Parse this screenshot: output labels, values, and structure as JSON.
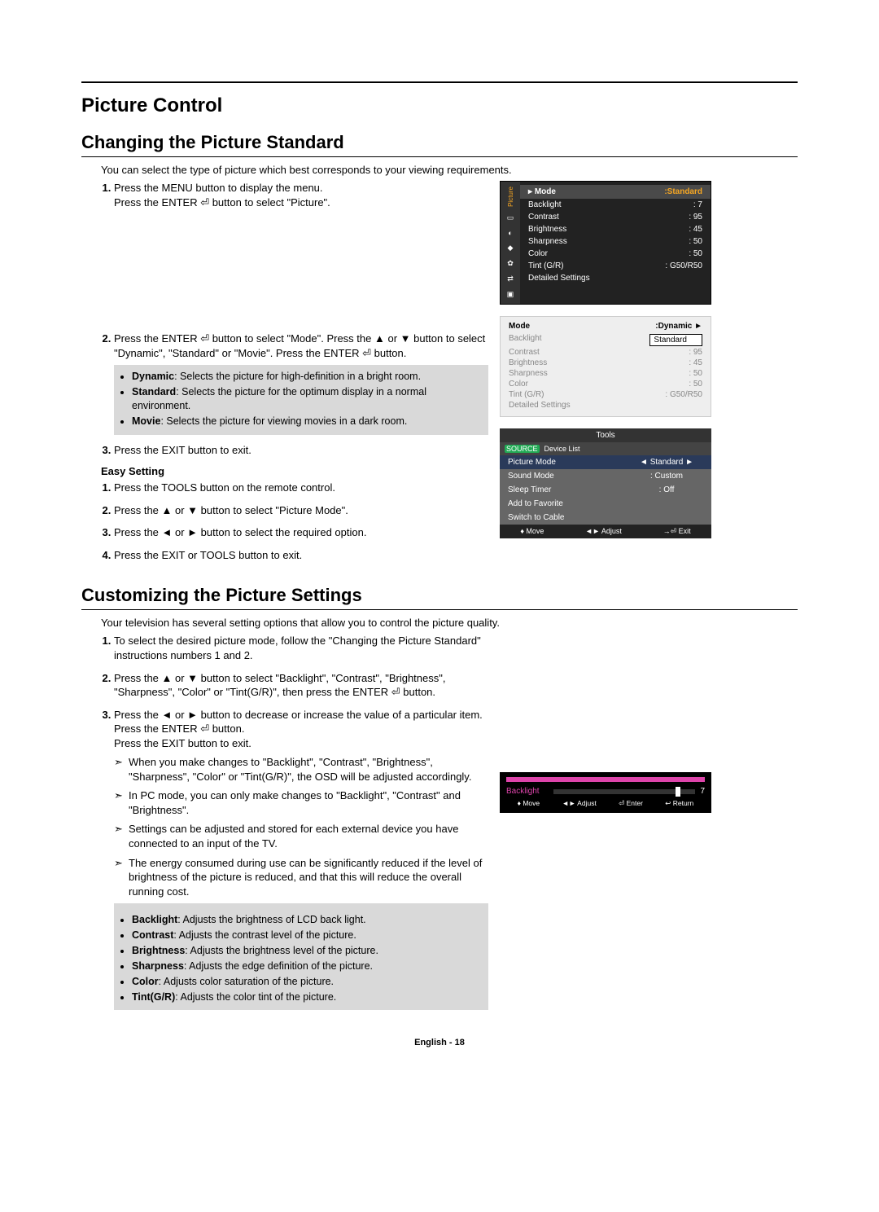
{
  "section1_title": "Picture Control",
  "section2_title": "Changing the Picture Standard",
  "intro1": "You can select the type of picture which best corresponds to your viewing requirements.",
  "step1a": "Press the MENU button to display the menu.",
  "step1b": "Press the ENTER ⏎ button to select \"Picture\".",
  "step2a": "Press the ENTER ⏎ button to select \"Mode\". Press the ▲ or ▼ button to select \"Dynamic\", \"Standard\" or \"Movie\". Press the ENTER ⏎ button.",
  "mode_dynamic_lbl": "Dynamic",
  "mode_dynamic_txt": ": Selects the picture for high-definition in a bright room.",
  "mode_standard_lbl": "Standard",
  "mode_standard_txt": ": Selects the picture for the optimum display in a normal environment.",
  "mode_movie_lbl": "Movie",
  "mode_movie_txt": ": Selects the picture for viewing movies in a dark room.",
  "step3": "Press the EXIT button to exit.",
  "easy_title": "Easy Setting",
  "easy1": "Press the TOOLS button on the remote control.",
  "easy2": "Press the ▲ or ▼ button to select \"Picture Mode\".",
  "easy3": "Press the ◄ or ► button to select the required option.",
  "easy4": "Press the EXIT or TOOLS button to exit.",
  "section3_title": "Customizing the Picture Settings",
  "intro2": "Your television has several setting options that allow you to control the picture quality.",
  "c_step1": "To select the desired picture mode, follow the \"Changing the Picture Standard\" instructions numbers 1 and 2.",
  "c_step2": "Press the ▲ or ▼ button to select \"Backlight\", \"Contrast\", \"Brightness\", \"Sharpness\", \"Color\" or \"Tint(G/R)\", then press the ENTER ⏎ button.",
  "c_step3a": "Press the ◄ or ► button to decrease or increase the value of a particular item. Press the ENTER ⏎ button.",
  "c_step3b": "Press the EXIT button to exit.",
  "note1": "When you make changes to \"Backlight\", \"Contrast\", \"Brightness\", \"Sharpness\", \"Color\" or \"Tint(G/R)\", the OSD will be adjusted accordingly.",
  "note2": "In PC mode, you can only make changes to \"Backlight\", \"Contrast\" and \"Brightness\".",
  "note3": "Settings can be adjusted and stored for each external device you have connected to an input of the TV.",
  "note4": "The energy consumed during use can be significantly reduced if the level of brightness of the picture is reduced, and that this will reduce the overall running cost.",
  "def_backlight_l": "Backlight",
  "def_backlight_t": ": Adjusts the brightness of LCD back light.",
  "def_contrast_l": "Contrast",
  "def_contrast_t": ": Adjusts the contrast level of the picture.",
  "def_brightness_l": "Brightness",
  "def_brightness_t": ": Adjusts the brightness level of the picture.",
  "def_sharpness_l": "Sharpness",
  "def_sharpness_t": ": Adjusts the edge definition of the picture.",
  "def_color_l": "Color",
  "def_color_t": ": Adjusts color saturation of the picture.",
  "def_tint_l": "Tint(G/R)",
  "def_tint_t": ": Adjusts the color tint of the picture.",
  "footer": "English - 18",
  "osd1": {
    "tab": "Picture",
    "head_l": "Mode",
    "head_r": ":Standard",
    "rows": [
      {
        "l": "Backlight",
        "r": ": 7"
      },
      {
        "l": "Contrast",
        "r": ": 95"
      },
      {
        "l": "Brightness",
        "r": ": 45"
      },
      {
        "l": "Sharpness",
        "r": ": 50"
      },
      {
        "l": "Color",
        "r": ": 50"
      },
      {
        "l": "Tint (G/R)",
        "r": ": G50/R50"
      },
      {
        "l": "Detailed Settings",
        "r": ""
      }
    ]
  },
  "osd2": {
    "head_l": "Mode",
    "head_r": ":Dynamic   ►",
    "sel": "Standard",
    "rows": [
      {
        "l": "Backlight",
        "r": ""
      },
      {
        "l": "Contrast",
        "r": ": 95"
      },
      {
        "l": "Brightness",
        "r": ": 45"
      },
      {
        "l": "Sharpness",
        "r": ": 50"
      },
      {
        "l": "Color",
        "r": ": 50"
      },
      {
        "l": "Tint (G/R)",
        "r": ": G50/R50"
      },
      {
        "l": "Detailed Settings",
        "r": ""
      }
    ]
  },
  "tools": {
    "title": "Tools",
    "device": "Device List",
    "rows": [
      {
        "l": "Picture Mode",
        "v": "◄   Standard   ►",
        "hl": true
      },
      {
        "l": "Sound Mode",
        "v": ":        Custom",
        "hl": false
      },
      {
        "l": "Sleep Timer",
        "v": ":           Off",
        "hl": false
      },
      {
        "l": "Add to Favorite",
        "v": "",
        "hl": false
      },
      {
        "l": "Switch to Cable",
        "v": "",
        "hl": false
      }
    ],
    "foot": [
      "♦ Move",
      "◄► Adjust",
      "→⏎ Exit"
    ]
  },
  "slider": {
    "label": "Backlight",
    "value": "7",
    "foot": [
      "♦ Move",
      "◄► Adjust",
      "⏎ Enter",
      "↩ Return"
    ]
  }
}
